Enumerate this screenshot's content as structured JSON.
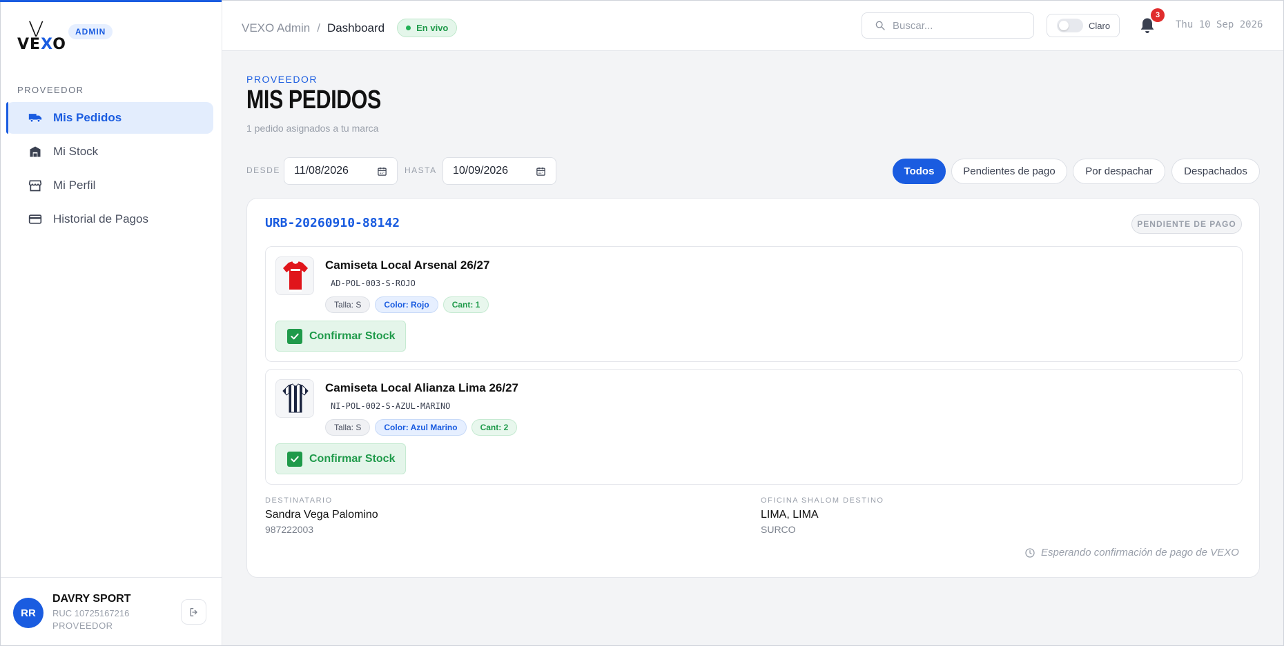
{
  "brand": {
    "logo_letter": "V",
    "logo_word_start": "VE",
    "logo_word_x": "X",
    "logo_word_end": "O",
    "badge": "ADMIN",
    "accent": "#1a5ce0"
  },
  "sidebar": {
    "section": "PROVEEDOR",
    "items": [
      {
        "label": "Mis Pedidos",
        "icon": "truck-icon",
        "active": true
      },
      {
        "label": "Mi Stock",
        "icon": "warehouse-icon",
        "active": false
      },
      {
        "label": "Mi Perfil",
        "icon": "store-icon",
        "active": false
      },
      {
        "label": "Historial de Pagos",
        "icon": "credit-card-icon",
        "active": false
      }
    ],
    "user": {
      "initials": "RR",
      "name": "DAVRY SPORT",
      "ruc": "RUC 10725167216",
      "role": "PROVEEDOR"
    }
  },
  "header": {
    "crumb_root": "VEXO Admin",
    "crumb_sep": "/",
    "crumb_current": "Dashboard",
    "live": "En vivo",
    "search_placeholder": "Buscar...",
    "theme_label": "Claro",
    "notifications": "3",
    "date": "Thu 10 Sep 2026"
  },
  "main": {
    "eyebrow": "PROVEEDOR",
    "title": "MIS PEDIDOS",
    "subtitle": "1 pedido asignados a tu marca",
    "filters": {
      "from_label": "DESDE",
      "from_value": "11/08/2026",
      "to_label": "HASTA",
      "to_value": "10/09/2026",
      "pills": [
        "Todos",
        "Pendientes de pago",
        "Por despachar",
        "Despachados"
      ],
      "active_pill": "Todos"
    },
    "order": {
      "id": "URB-20260910-88142",
      "status": "PENDIENTE DE PAGO",
      "items": [
        {
          "name": "Camiseta Local Arsenal 26/27",
          "sku": "AD-POL-003-S-ROJO",
          "size": "Talla: S",
          "color": "Color: Rojo",
          "qty": "Cant: 1",
          "confirm": "Confirmar Stock"
        },
        {
          "name": "Camiseta Local Alianza Lima 26/27",
          "sku": "NI-POL-002-S-AZUL-MARINO",
          "size": "Talla: S",
          "color": "Color: Azul Marino",
          "qty": "Cant: 2",
          "confirm": "Confirmar Stock"
        }
      ],
      "recipient_label": "DESTINATARIO",
      "recipient_name": "Sandra Vega Palomino",
      "recipient_phone": "987222003",
      "office_label": "OFICINA SHALOM DESTINO",
      "office_city": "LIMA, LIMA",
      "office_district": "SURCO",
      "waiting": "Esperando confirmación de pago de VEXO"
    }
  }
}
